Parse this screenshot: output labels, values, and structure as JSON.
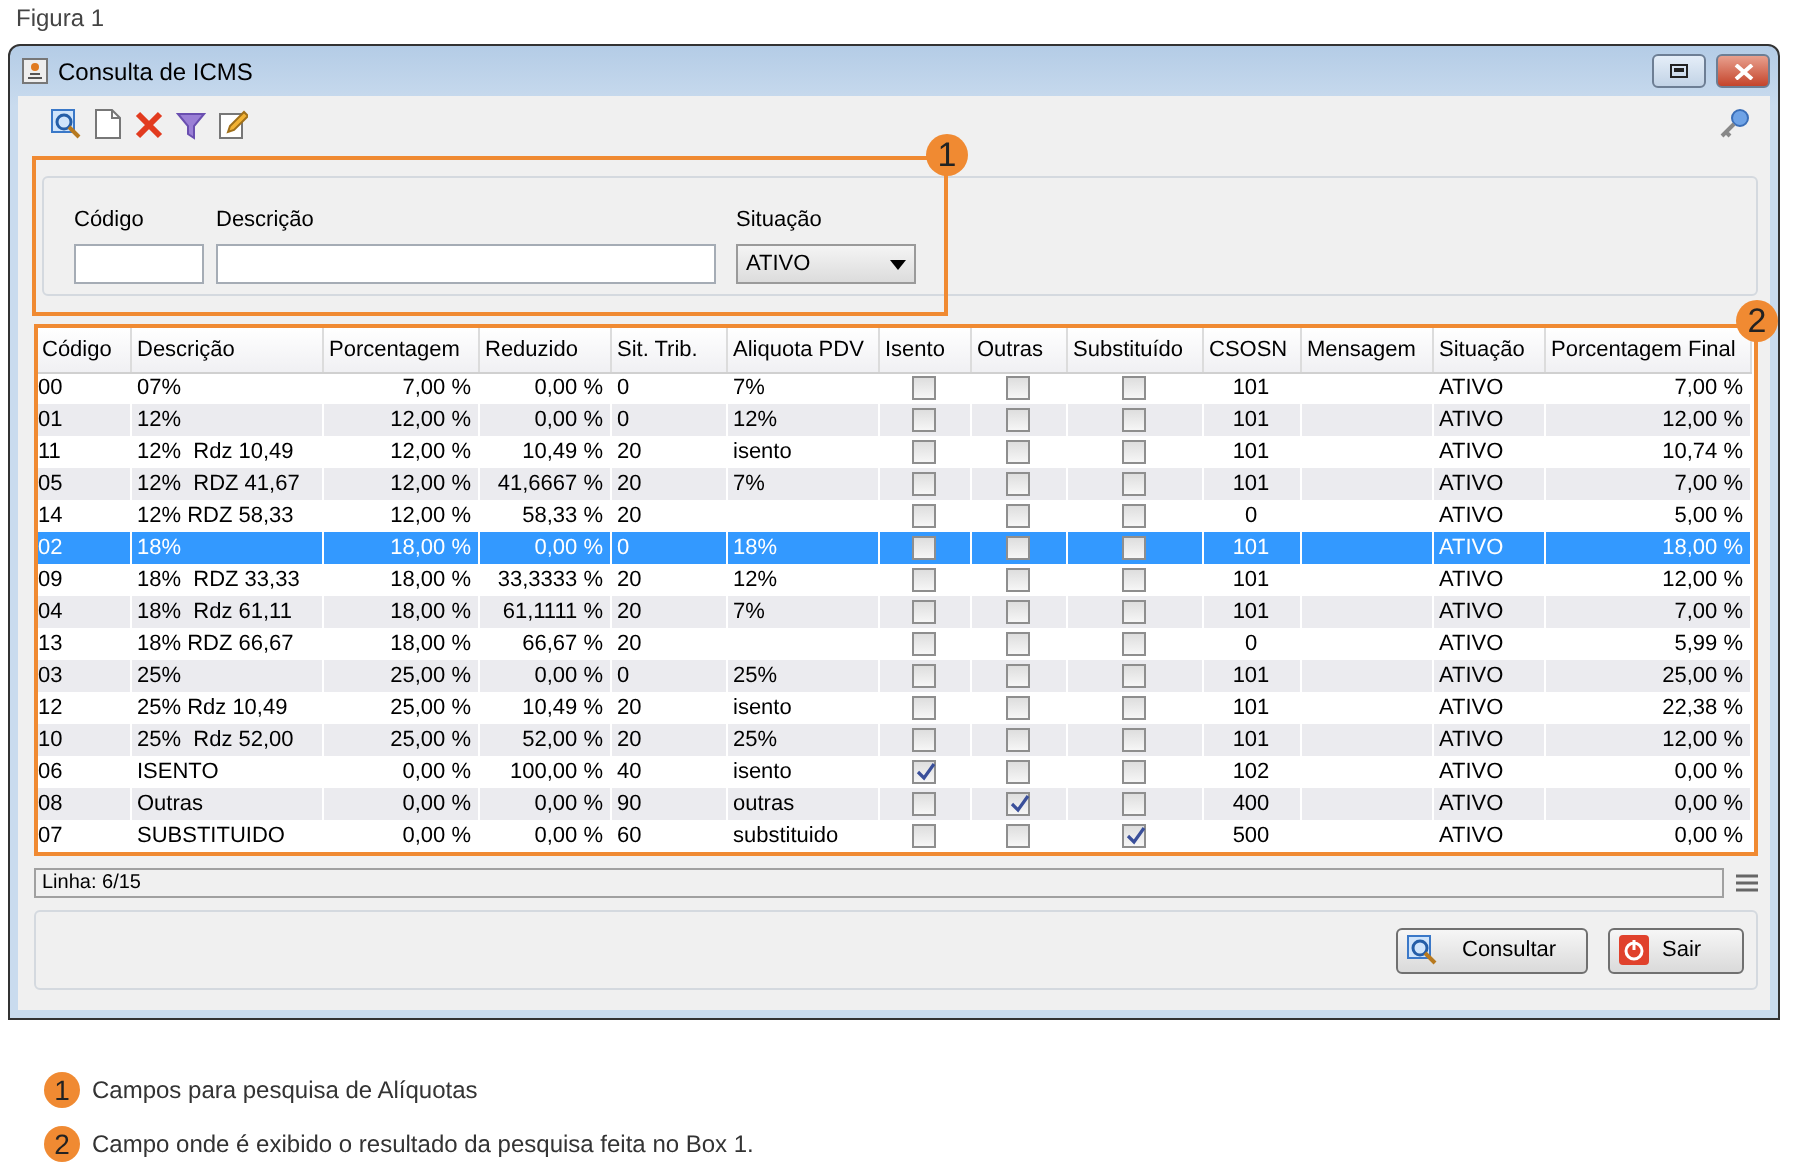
{
  "caption": "Figura 1",
  "window": {
    "title": "Consulta de ICMS"
  },
  "filters": {
    "callout": "1",
    "fields": [
      {
        "label": "Código",
        "kind": "text"
      },
      {
        "label": "Descrição",
        "kind": "text"
      },
      {
        "label": "Situação",
        "kind": "select",
        "value": "ATIVO"
      }
    ]
  },
  "table": {
    "callout": "2",
    "columns": [
      "Código",
      "Descrição",
      "Porcentagem",
      "Reduzido",
      "Sit. Trib.",
      "Aliquota PDV",
      "Isento",
      "Outras",
      "Substituído",
      "CSOSN",
      "Mensagem",
      "Situação",
      "Porcentagem Final"
    ],
    "rows": [
      {
        "codigo": "00",
        "descricao": "07%",
        "porcentagem": "7,00 %",
        "reduzido": "0,00 %",
        "sit_trib": "0",
        "aliquota_pdv": "7%",
        "isento": false,
        "outras": false,
        "substituido": false,
        "csosn": "101",
        "situacao": "ATIVO",
        "porcentagem_final": "7,00 %",
        "selected": false
      },
      {
        "codigo": "01",
        "descricao": "12%",
        "porcentagem": "12,00 %",
        "reduzido": "0,00 %",
        "sit_trib": "0",
        "aliquota_pdv": "12%",
        "isento": false,
        "outras": false,
        "substituido": false,
        "csosn": "101",
        "situacao": "ATIVO",
        "porcentagem_final": "12,00 %",
        "selected": false
      },
      {
        "codigo": "11",
        "descricao": "12%  Rdz 10,49",
        "porcentagem": "12,00 %",
        "reduzido": "10,49 %",
        "sit_trib": "20",
        "aliquota_pdv": "isento",
        "isento": false,
        "outras": false,
        "substituido": false,
        "csosn": "101",
        "situacao": "ATIVO",
        "porcentagem_final": "10,74 %",
        "selected": false
      },
      {
        "codigo": "05",
        "descricao": "12%  RDZ 41,67",
        "porcentagem": "12,00 %",
        "reduzido": "41,6667 %",
        "sit_trib": "20",
        "aliquota_pdv": "7%",
        "isento": false,
        "outras": false,
        "substituido": false,
        "csosn": "101",
        "situacao": "ATIVO",
        "porcentagem_final": "7,00 %",
        "selected": false
      },
      {
        "codigo": "14",
        "descricao": "12% RDZ 58,33",
        "porcentagem": "12,00 %",
        "reduzido": "58,33 %",
        "sit_trib": "20",
        "isento": false,
        "outras": false,
        "substituido": false,
        "csosn": "0",
        "situacao": "ATIVO",
        "porcentagem_final": "5,00 %",
        "selected": false
      },
      {
        "codigo": "02",
        "descricao": "18%",
        "porcentagem": "18,00 %",
        "reduzido": "0,00 %",
        "sit_trib": "0",
        "aliquota_pdv": "18%",
        "isento": false,
        "outras": false,
        "substituido": false,
        "csosn": "101",
        "situacao": "ATIVO",
        "porcentagem_final": "18,00 %",
        "selected": true
      },
      {
        "codigo": "09",
        "descricao": "18%  RDZ 33,33",
        "porcentagem": "18,00 %",
        "reduzido": "33,3333 %",
        "sit_trib": "20",
        "aliquota_pdv": "12%",
        "isento": false,
        "outras": false,
        "substituido": false,
        "csosn": "101",
        "situacao": "ATIVO",
        "porcentagem_final": "12,00 %",
        "selected": false
      },
      {
        "codigo": "04",
        "descricao": "18%  Rdz 61,11",
        "porcentagem": "18,00 %",
        "reduzido": "61,1111 %",
        "sit_trib": "20",
        "aliquota_pdv": "7%",
        "isento": false,
        "outras": false,
        "substituido": false,
        "csosn": "101",
        "situacao": "ATIVO",
        "porcentagem_final": "7,00 %",
        "selected": false
      },
      {
        "codigo": "13",
        "descricao": "18% RDZ 66,67",
        "porcentagem": "18,00 %",
        "reduzido": "66,67 %",
        "sit_trib": "20",
        "isento": false,
        "outras": false,
        "substituido": false,
        "csosn": "0",
        "situacao": "ATIVO",
        "porcentagem_final": "5,99 %",
        "selected": false
      },
      {
        "codigo": "03",
        "descricao": "25%",
        "porcentagem": "25,00 %",
        "reduzido": "0,00 %",
        "sit_trib": "0",
        "aliquota_pdv": "25%",
        "isento": false,
        "outras": false,
        "substituido": false,
        "csosn": "101",
        "situacao": "ATIVO",
        "porcentagem_final": "25,00 %",
        "selected": false
      },
      {
        "codigo": "12",
        "descricao": "25% Rdz 10,49",
        "porcentagem": "25,00 %",
        "reduzido": "10,49 %",
        "sit_trib": "20",
        "aliquota_pdv": "isento",
        "isento": false,
        "outras": false,
        "substituido": false,
        "csosn": "101",
        "situacao": "ATIVO",
        "porcentagem_final": "22,38 %",
        "selected": false
      },
      {
        "codigo": "10",
        "descricao": "25%  Rdz 52,00",
        "porcentagem": "25,00 %",
        "reduzido": "52,00 %",
        "sit_trib": "20",
        "aliquota_pdv": "25%",
        "isento": false,
        "outras": false,
        "substituido": false,
        "csosn": "101",
        "situacao": "ATIVO",
        "porcentagem_final": "12,00 %",
        "selected": false
      },
      {
        "codigo": "06",
        "descricao": "ISENTO",
        "porcentagem": "0,00 %",
        "reduzido": "100,00 %",
        "sit_trib": "40",
        "aliquota_pdv": "isento",
        "isento": true,
        "outras": false,
        "substituido": false,
        "csosn": "102",
        "situacao": "ATIVO",
        "porcentagem_final": "0,00 %",
        "selected": false
      },
      {
        "codigo": "08",
        "descricao": "Outras",
        "porcentagem": "0,00 %",
        "reduzido": "0,00 %",
        "sit_trib": "90",
        "aliquota_pdv": "outras",
        "isento": false,
        "outras": true,
        "substituido": false,
        "csosn": "400",
        "situacao": "ATIVO",
        "porcentagem_final": "0,00 %",
        "selected": false
      },
      {
        "codigo": "07",
        "descricao": "SUBSTITUIDO",
        "porcentagem": "0,00 %",
        "reduzido": "0,00 %",
        "sit_trib": "60",
        "aliquota_pdv": "substituido",
        "isento": false,
        "outras": false,
        "substituido": true,
        "csosn": "500",
        "situacao": "ATIVO",
        "porcentagem_final": "0,00 %",
        "selected": false
      }
    ]
  },
  "status_bar": {
    "text": "Linha: 6/15"
  },
  "buttons": [
    {
      "label": "Consultar",
      "kind": "search"
    },
    {
      "label": "Sair",
      "kind": "exit"
    }
  ],
  "legend": [
    {
      "badge": "1",
      "text": "Campos para pesquisa de Alíquotas"
    },
    {
      "badge": "2",
      "text": "Campo onde é exibido o resultado da pesquisa feita no Box 1."
    }
  ]
}
